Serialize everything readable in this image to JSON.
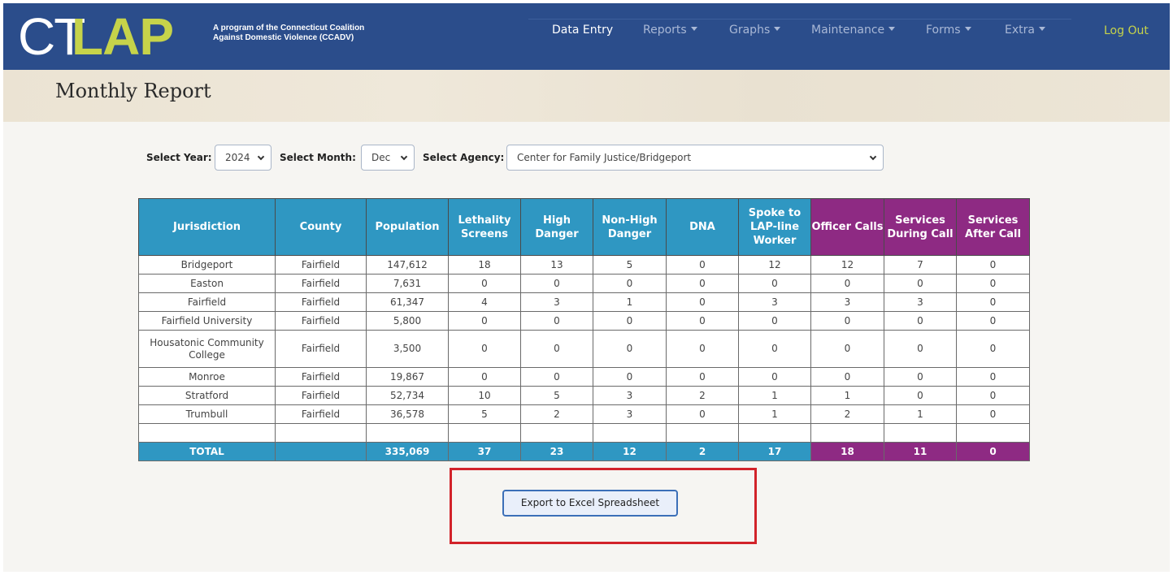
{
  "brand": {
    "logo_ct": "CT",
    "logo_lap": "LAP",
    "tagline_line1": "A program of the Connecticut Coalition",
    "tagline_line2": "Against Domestic Violence (CCADV)"
  },
  "nav": {
    "items": [
      {
        "label": "Data Entry",
        "dropdown": false
      },
      {
        "label": "Reports",
        "dropdown": true
      },
      {
        "label": "Graphs",
        "dropdown": true
      },
      {
        "label": "Maintenance",
        "dropdown": true
      },
      {
        "label": "Forms",
        "dropdown": true
      },
      {
        "label": "Extra",
        "dropdown": true
      }
    ],
    "logout": "Log Out"
  },
  "page": {
    "title": "Monthly Report"
  },
  "filters": {
    "year_label": "Select Year:",
    "year_value": "2024",
    "month_label": "Select Month:",
    "month_value": "Dec",
    "agency_label": "Select Agency:",
    "agency_value": "Center for Family Justice/Bridgeport"
  },
  "table": {
    "headers": [
      "Jurisdiction",
      "County",
      "Population",
      "Lethality Screens",
      "High Danger",
      "Non-High Danger",
      "DNA",
      "Spoke to LAP-line Worker",
      "Officer Calls",
      "Services During Call",
      "Services After Call"
    ],
    "rows": [
      {
        "jurisdiction": "Bridgeport",
        "county": "Fairfield",
        "population": "147,612",
        "lethality": "18",
        "high": "13",
        "nonhigh": "5",
        "dna": "0",
        "spoke": "12",
        "officer": "12",
        "during": "7",
        "after": "0"
      },
      {
        "jurisdiction": "Easton",
        "county": "Fairfield",
        "population": "7,631",
        "lethality": "0",
        "high": "0",
        "nonhigh": "0",
        "dna": "0",
        "spoke": "0",
        "officer": "0",
        "during": "0",
        "after": "0"
      },
      {
        "jurisdiction": "Fairfield",
        "county": "Fairfield",
        "population": "61,347",
        "lethality": "4",
        "high": "3",
        "nonhigh": "1",
        "dna": "0",
        "spoke": "3",
        "officer": "3",
        "during": "3",
        "after": "0"
      },
      {
        "jurisdiction": "Fairfield University",
        "county": "Fairfield",
        "population": "5,800",
        "lethality": "0",
        "high": "0",
        "nonhigh": "0",
        "dna": "0",
        "spoke": "0",
        "officer": "0",
        "during": "0",
        "after": "0"
      },
      {
        "jurisdiction": "Housatonic Community College",
        "county": "Fairfield",
        "population": "3,500",
        "lethality": "0",
        "high": "0",
        "nonhigh": "0",
        "dna": "0",
        "spoke": "0",
        "officer": "0",
        "during": "0",
        "after": "0"
      },
      {
        "jurisdiction": "Monroe",
        "county": "Fairfield",
        "population": "19,867",
        "lethality": "0",
        "high": "0",
        "nonhigh": "0",
        "dna": "0",
        "spoke": "0",
        "officer": "0",
        "during": "0",
        "after": "0"
      },
      {
        "jurisdiction": "Stratford",
        "county": "Fairfield",
        "population": "52,734",
        "lethality": "10",
        "high": "5",
        "nonhigh": "3",
        "dna": "2",
        "spoke": "1",
        "officer": "1",
        "during": "0",
        "after": "0"
      },
      {
        "jurisdiction": "Trumbull",
        "county": "Fairfield",
        "population": "36,578",
        "lethality": "5",
        "high": "2",
        "nonhigh": "3",
        "dna": "0",
        "spoke": "1",
        "officer": "2",
        "during": "1",
        "after": "0"
      }
    ],
    "total": {
      "label": "TOTAL",
      "county": "",
      "population": "335,069",
      "lethality": "37",
      "high": "23",
      "nonhigh": "12",
      "dna": "2",
      "spoke": "17",
      "officer": "18",
      "during": "11",
      "after": "0"
    }
  },
  "export": {
    "label": "Export to Excel Spreadsheet"
  },
  "colors": {
    "navbar": "#2b4d8b",
    "accent_green": "#c6d34a",
    "header_blue": "#2f97c2",
    "header_purple": "#8e2a83",
    "highlight_pink": "#f7cbcb",
    "annotation_red": "#d2232a"
  }
}
